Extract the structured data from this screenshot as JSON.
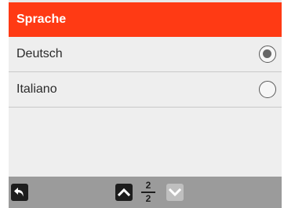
{
  "header": {
    "title": "Sprache"
  },
  "options": [
    {
      "label": "Deutsch",
      "selected": true
    },
    {
      "label": "Italiano",
      "selected": false
    }
  ],
  "footer": {
    "page_current": "2",
    "page_total": "2",
    "icons": {
      "back": "back-arrow-icon",
      "up": "chevron-up-icon",
      "down": "chevron-down-icon"
    }
  },
  "colors": {
    "header_bg": "#ff3a14",
    "footer_bg": "#9b9b9b",
    "list_bg": "#eeeeee",
    "button_dark": "#1d1d1d",
    "button_disabled": "#bfbfbf"
  }
}
